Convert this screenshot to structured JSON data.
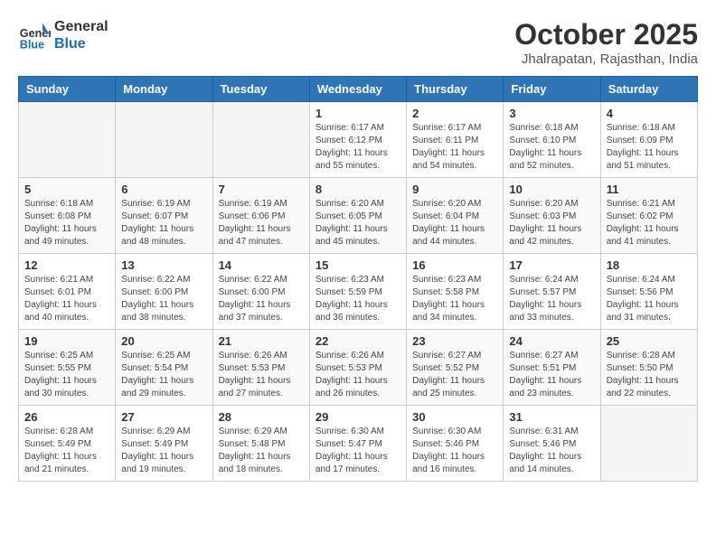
{
  "header": {
    "logo_line1": "General",
    "logo_line2": "Blue",
    "month": "October 2025",
    "location": "Jhalrapatan, Rajasthan, India"
  },
  "days_of_week": [
    "Sunday",
    "Monday",
    "Tuesday",
    "Wednesday",
    "Thursday",
    "Friday",
    "Saturday"
  ],
  "weeks": [
    [
      {
        "day": "",
        "info": ""
      },
      {
        "day": "",
        "info": ""
      },
      {
        "day": "",
        "info": ""
      },
      {
        "day": "1",
        "info": "Sunrise: 6:17 AM\nSunset: 6:12 PM\nDaylight: 11 hours\nand 55 minutes."
      },
      {
        "day": "2",
        "info": "Sunrise: 6:17 AM\nSunset: 6:11 PM\nDaylight: 11 hours\nand 54 minutes."
      },
      {
        "day": "3",
        "info": "Sunrise: 6:18 AM\nSunset: 6:10 PM\nDaylight: 11 hours\nand 52 minutes."
      },
      {
        "day": "4",
        "info": "Sunrise: 6:18 AM\nSunset: 6:09 PM\nDaylight: 11 hours\nand 51 minutes."
      }
    ],
    [
      {
        "day": "5",
        "info": "Sunrise: 6:18 AM\nSunset: 6:08 PM\nDaylight: 11 hours\nand 49 minutes."
      },
      {
        "day": "6",
        "info": "Sunrise: 6:19 AM\nSunset: 6:07 PM\nDaylight: 11 hours\nand 48 minutes."
      },
      {
        "day": "7",
        "info": "Sunrise: 6:19 AM\nSunset: 6:06 PM\nDaylight: 11 hours\nand 47 minutes."
      },
      {
        "day": "8",
        "info": "Sunrise: 6:20 AM\nSunset: 6:05 PM\nDaylight: 11 hours\nand 45 minutes."
      },
      {
        "day": "9",
        "info": "Sunrise: 6:20 AM\nSunset: 6:04 PM\nDaylight: 11 hours\nand 44 minutes."
      },
      {
        "day": "10",
        "info": "Sunrise: 6:20 AM\nSunset: 6:03 PM\nDaylight: 11 hours\nand 42 minutes."
      },
      {
        "day": "11",
        "info": "Sunrise: 6:21 AM\nSunset: 6:02 PM\nDaylight: 11 hours\nand 41 minutes."
      }
    ],
    [
      {
        "day": "12",
        "info": "Sunrise: 6:21 AM\nSunset: 6:01 PM\nDaylight: 11 hours\nand 40 minutes."
      },
      {
        "day": "13",
        "info": "Sunrise: 6:22 AM\nSunset: 6:00 PM\nDaylight: 11 hours\nand 38 minutes."
      },
      {
        "day": "14",
        "info": "Sunrise: 6:22 AM\nSunset: 6:00 PM\nDaylight: 11 hours\nand 37 minutes."
      },
      {
        "day": "15",
        "info": "Sunrise: 6:23 AM\nSunset: 5:59 PM\nDaylight: 11 hours\nand 36 minutes."
      },
      {
        "day": "16",
        "info": "Sunrise: 6:23 AM\nSunset: 5:58 PM\nDaylight: 11 hours\nand 34 minutes."
      },
      {
        "day": "17",
        "info": "Sunrise: 6:24 AM\nSunset: 5:57 PM\nDaylight: 11 hours\nand 33 minutes."
      },
      {
        "day": "18",
        "info": "Sunrise: 6:24 AM\nSunset: 5:56 PM\nDaylight: 11 hours\nand 31 minutes."
      }
    ],
    [
      {
        "day": "19",
        "info": "Sunrise: 6:25 AM\nSunset: 5:55 PM\nDaylight: 11 hours\nand 30 minutes."
      },
      {
        "day": "20",
        "info": "Sunrise: 6:25 AM\nSunset: 5:54 PM\nDaylight: 11 hours\nand 29 minutes."
      },
      {
        "day": "21",
        "info": "Sunrise: 6:26 AM\nSunset: 5:53 PM\nDaylight: 11 hours\nand 27 minutes."
      },
      {
        "day": "22",
        "info": "Sunrise: 6:26 AM\nSunset: 5:53 PM\nDaylight: 11 hours\nand 26 minutes."
      },
      {
        "day": "23",
        "info": "Sunrise: 6:27 AM\nSunset: 5:52 PM\nDaylight: 11 hours\nand 25 minutes."
      },
      {
        "day": "24",
        "info": "Sunrise: 6:27 AM\nSunset: 5:51 PM\nDaylight: 11 hours\nand 23 minutes."
      },
      {
        "day": "25",
        "info": "Sunrise: 6:28 AM\nSunset: 5:50 PM\nDaylight: 11 hours\nand 22 minutes."
      }
    ],
    [
      {
        "day": "26",
        "info": "Sunrise: 6:28 AM\nSunset: 5:49 PM\nDaylight: 11 hours\nand 21 minutes."
      },
      {
        "day": "27",
        "info": "Sunrise: 6:29 AM\nSunset: 5:49 PM\nDaylight: 11 hours\nand 19 minutes."
      },
      {
        "day": "28",
        "info": "Sunrise: 6:29 AM\nSunset: 5:48 PM\nDaylight: 11 hours\nand 18 minutes."
      },
      {
        "day": "29",
        "info": "Sunrise: 6:30 AM\nSunset: 5:47 PM\nDaylight: 11 hours\nand 17 minutes."
      },
      {
        "day": "30",
        "info": "Sunrise: 6:30 AM\nSunset: 5:46 PM\nDaylight: 11 hours\nand 16 minutes."
      },
      {
        "day": "31",
        "info": "Sunrise: 6:31 AM\nSunset: 5:46 PM\nDaylight: 11 hours\nand 14 minutes."
      },
      {
        "day": "",
        "info": ""
      }
    ]
  ]
}
